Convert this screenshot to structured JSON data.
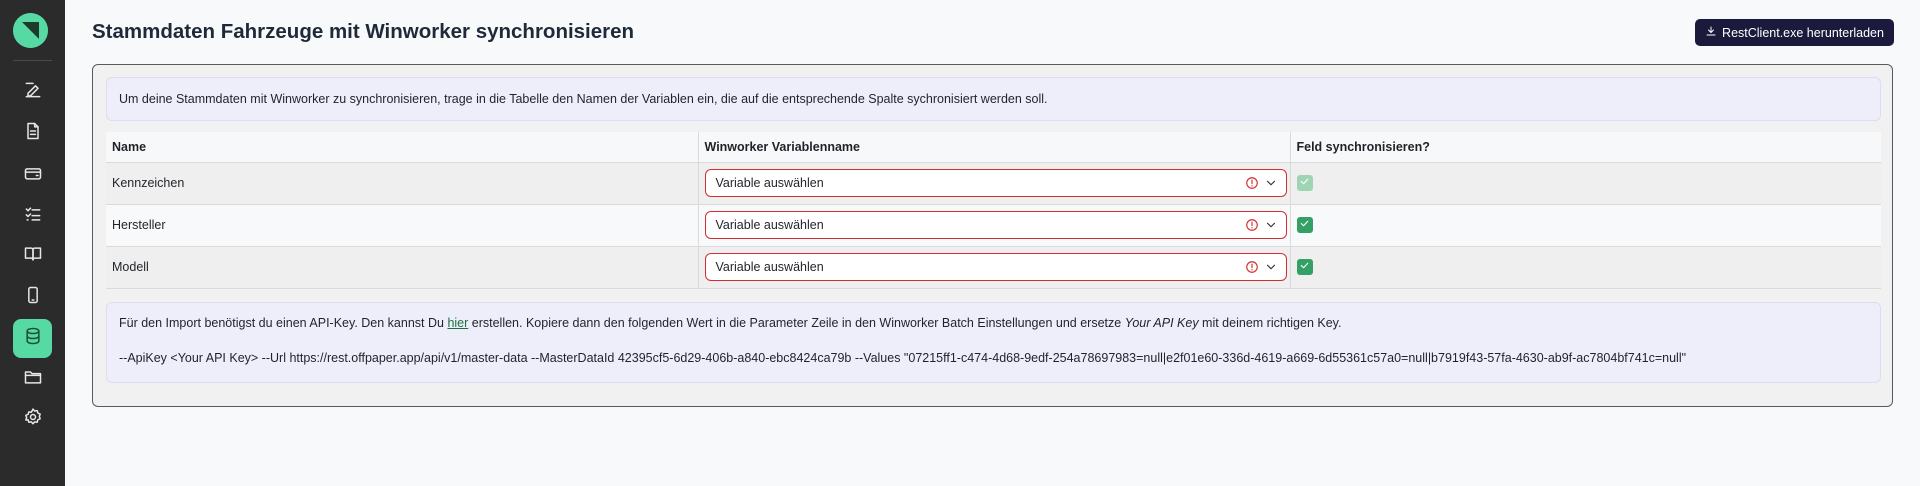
{
  "page": {
    "title": "Stammdaten Fahrzeuge mit Winworker synchronisieren",
    "download_button": "RestClient.exe herunterladen"
  },
  "sidebar": {
    "logo_icon": "app-logo",
    "items": [
      {
        "icon": "edit-icon",
        "active": false
      },
      {
        "icon": "document-icon",
        "active": false
      },
      {
        "icon": "wallet-icon",
        "active": false
      },
      {
        "icon": "checklist-icon",
        "active": false
      },
      {
        "icon": "book-icon",
        "active": false
      },
      {
        "icon": "mobile-icon",
        "active": false
      },
      {
        "icon": "database-icon",
        "active": true
      },
      {
        "icon": "folder-icon",
        "active": false
      },
      {
        "icon": "settings-icon",
        "active": false
      }
    ]
  },
  "info_text": "Um deine Stammdaten mit Winworker zu synchronisieren, trage in die Tabelle den Namen der Variablen ein, die auf die entsprechende Spalte sychronisiert werden soll.",
  "table": {
    "headers": [
      "Name",
      "Winworker Variablenname",
      "Feld synchronisieren?"
    ],
    "rows": [
      {
        "name": "Kennzeichen",
        "variable": "Variable auswählen",
        "sync": true,
        "sync_disabled": true
      },
      {
        "name": "Hersteller",
        "variable": "Variable auswählen",
        "sync": true,
        "sync_disabled": false
      },
      {
        "name": "Modell",
        "variable": "Variable auswählen",
        "sync": true,
        "sync_disabled": false
      }
    ]
  },
  "api": {
    "text_before_link": "Für den Import benötigst du einen API-Key. Den kannst Du ",
    "link_text": "hier",
    "text_after_link": " erstellen. Kopiere dann den folgenden Wert in die Parameter Zeile in den Winworker Batch Einstellungen und ersetze ",
    "emphasis": "Your API Key",
    "text_end": " mit deinem richtigen Key.",
    "command": "--ApiKey <Your API Key> --Url https://rest.offpaper.app/api/v1/master-data --MasterDataId 42395cf5-6d29-406b-a840-ebc8424ca79b --Values \"07215ff1-c474-4d68-9edf-254a78697983=null|e2f01e60-336d-4619-a669-6d55361c57a0=null|b7919f43-57fa-4630-ab9f-ac7804bf741c=null\""
  },
  "colors": {
    "accent": "#57d9a3",
    "sidebar_bg": "#2b2b2b",
    "button_bg": "#1b1a3d",
    "error": "#d32f2f",
    "checkbox": "#34a065"
  }
}
